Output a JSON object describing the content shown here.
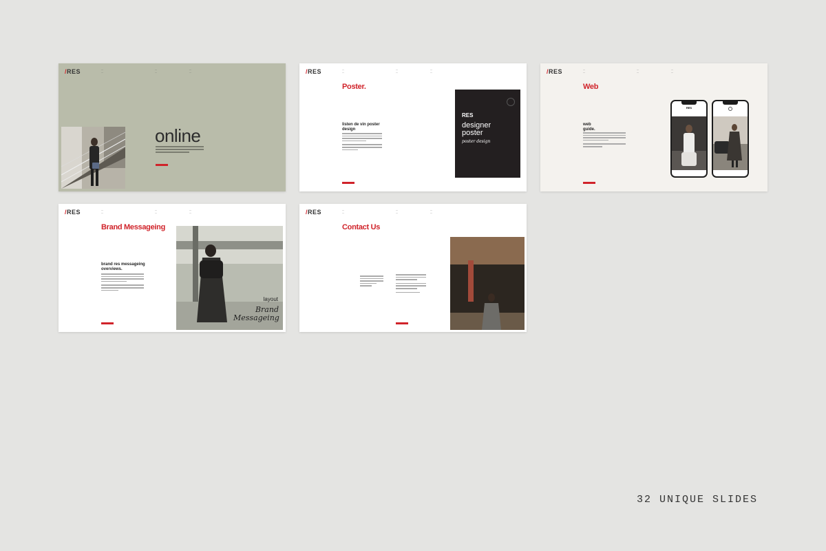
{
  "caption": "32 UNIQUE SLIDES",
  "colors": {
    "accent": "#d0232a",
    "sage": "#b9bcaa",
    "dark": "#231f20",
    "background": "#e4e4e2"
  },
  "slides": [
    {
      "logo": "RES",
      "headline": "online",
      "theme": "sage"
    },
    {
      "logo": "RES",
      "title": "Poster.",
      "subhead": "listen de vin poster design",
      "poster": {
        "logo": "RES",
        "title": "designer poster",
        "script": "poster design"
      }
    },
    {
      "logo": "RES",
      "title": "Web",
      "subhead": "web guide.",
      "phone_logo": "RES"
    },
    {
      "logo": "RES",
      "title": "Brand Messageing",
      "subhead": "brand res messageing overviews.",
      "overlay": {
        "small": "layout",
        "script": "Brand Messageing"
      }
    },
    {
      "logo": "RES",
      "title": "Contact Us"
    }
  ]
}
